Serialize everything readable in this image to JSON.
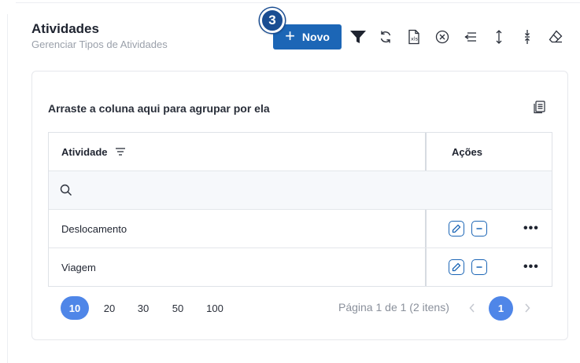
{
  "header": {
    "title": "Atividades",
    "subtitle": "Gerenciar Tipos de Atividades",
    "new_button_label": "Novo",
    "step_badge": "3"
  },
  "toolbar": {
    "icons": [
      "filter-icon",
      "refresh-icon",
      "export-excel-icon",
      "clear-filter-icon",
      "collapse-icon",
      "expand-rows-icon",
      "compact-rows-icon",
      "eraser-icon"
    ]
  },
  "grid": {
    "group_panel_text": "Arraste a coluna aqui para agrupar por ela",
    "columns": [
      {
        "label": "Atividade"
      },
      {
        "label": "Ações"
      }
    ],
    "rows": [
      {
        "atividade": "Deslocamento"
      },
      {
        "atividade": "Viagem"
      }
    ]
  },
  "pager": {
    "sizes": [
      "10",
      "20",
      "30",
      "50",
      "100"
    ],
    "active_size": "10",
    "info": "Página 1 de 1 (2 itens)",
    "current_page": "1"
  },
  "colors": {
    "primary": "#1c66b6",
    "badge": "#1a4d92",
    "pager_active": "#4f86e8"
  }
}
